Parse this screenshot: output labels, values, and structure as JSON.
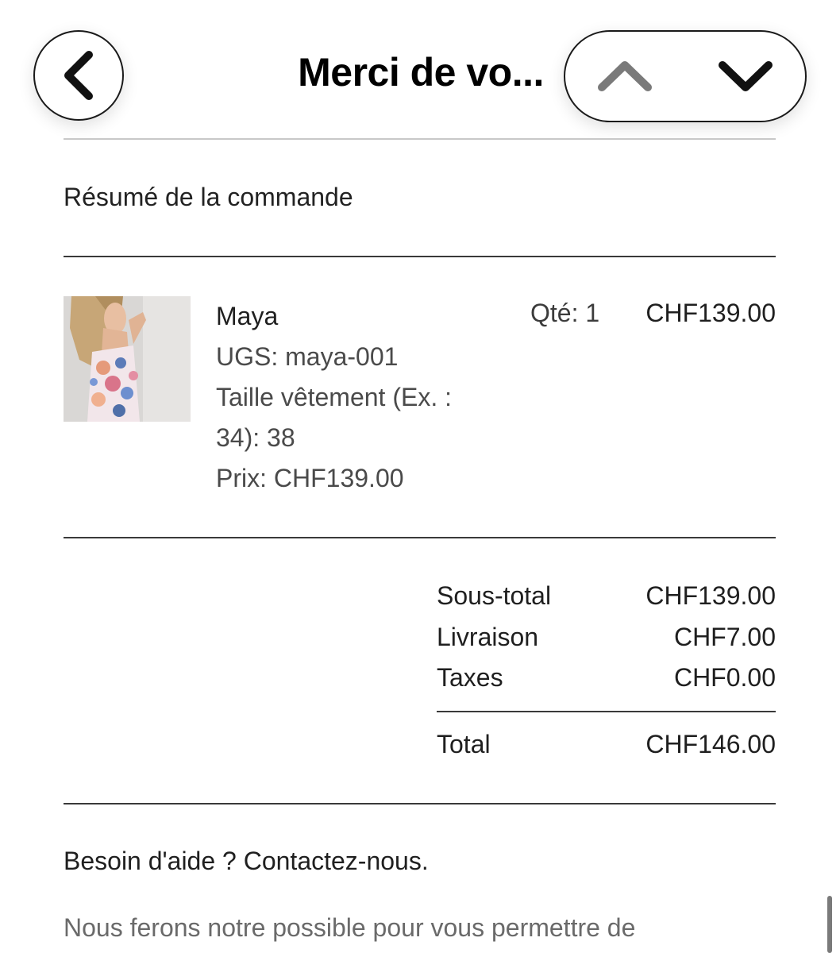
{
  "nav": {
    "title": "Merci de vo...",
    "back_icon": "chevron-left-icon",
    "up_icon": "chevron-up-icon",
    "down_icon": "chevron-down-icon"
  },
  "order_summary": {
    "title": "Résumé de la commande",
    "item": {
      "name": "Maya",
      "sku": "UGS: maya-001",
      "size_line1": "Taille vêtement (Ex. :",
      "size_line2": "34): 38",
      "price": "Prix: CHF139.00",
      "qty": "Qté: 1",
      "line_total": "CHF139.00"
    },
    "totals": {
      "subtotal_label": "Sous-total",
      "subtotal_value": "CHF139.00",
      "shipping_label": "Livraison",
      "shipping_value": "CHF7.00",
      "taxes_label": "Taxes",
      "taxes_value": "CHF0.00",
      "total_label": "Total",
      "total_value": "CHF146.00"
    }
  },
  "help": {
    "title": "Besoin d'aide ? Contactez-nous.",
    "text": "Nous ferons notre possible pour vous permettre de"
  }
}
